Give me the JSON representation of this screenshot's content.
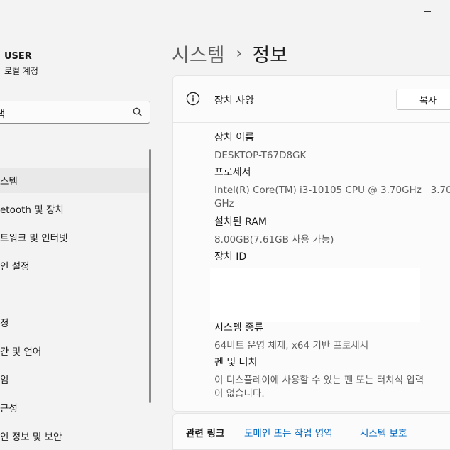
{
  "user": {
    "name": "USER",
    "account_type": "로컬 계정"
  },
  "search": {
    "value": "색"
  },
  "sidebar": {
    "items": [
      {
        "label": "스템",
        "active": true
      },
      {
        "label": "etooth 및 장치"
      },
      {
        "label": "트워크 및 인터넷"
      },
      {
        "label": "인 설정"
      },
      {
        "label": ""
      },
      {
        "label": "정"
      },
      {
        "label": "간 및 언어"
      },
      {
        "label": "임"
      },
      {
        "label": "근성"
      },
      {
        "label": "인 정보 및 보안"
      }
    ]
  },
  "breadcrumb": {
    "parent": "시스템",
    "separator": "›",
    "current": "정보"
  },
  "device_spec": {
    "title": "장치 사양",
    "copy_label": "복사",
    "device_name_label": "장치 이름",
    "device_name": "DESKTOP-T67D8GK",
    "processor_label": "프로세서",
    "processor_line1": "Intel(R) Core(TM) i3-10105 CPU @ 3.70GHz   3.70",
    "processor_line2": "GHz",
    "ram_label": "설치된 RAM",
    "ram": "8.00GB(7.61GB 사용 가능)",
    "device_id_label": "장치 ID",
    "system_type_label": "시스템 종류",
    "system_type": "64비트 운영 체제, x64 기반 프로세서",
    "pen_touch_label": "펜 및 터치",
    "pen_touch_line1": "이 디스플레이에 사용할 수 있는 펜 또는 터치식 입력",
    "pen_touch_line2": "이 없습니다."
  },
  "related_links": {
    "title": "관련 링크",
    "links": [
      "도메인 또는 작업 영역",
      "시스템 보호"
    ]
  },
  "colors": {
    "link": "#0067c0",
    "background": "#f3f3f3",
    "card": "#fbfbfb"
  }
}
